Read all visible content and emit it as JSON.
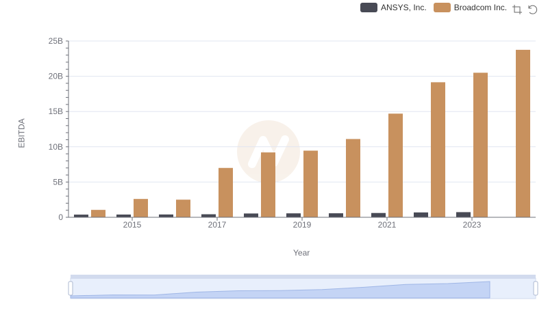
{
  "legend": [
    {
      "name": "ANSYS, Inc.",
      "color": "#484a55"
    },
    {
      "name": "Broadcom Inc.",
      "color": "#c8915e"
    }
  ],
  "toolbox": {
    "icons": [
      "zoom-icon",
      "restore-icon"
    ]
  },
  "chart_data": {
    "type": "bar",
    "categories": [
      "2014",
      "2015",
      "2016",
      "2017",
      "2018",
      "2019",
      "2020",
      "2021",
      "2022",
      "2023",
      "2024"
    ],
    "x_tick_labels": [
      "2015",
      "2017",
      "2019",
      "2021",
      "2023"
    ],
    "xlabel": "Year",
    "ylabel": "EBITDA",
    "ylim": [
      0,
      25000000000
    ],
    "y_tick_labels": [
      "0",
      "5B",
      "10B",
      "15B",
      "20B",
      "25B"
    ],
    "series": [
      {
        "name": "ANSYS, Inc.",
        "color": "#484a55",
        "values": [
          380000000,
          390000000,
          400000000,
          430000000,
          540000000,
          560000000,
          570000000,
          610000000,
          690000000,
          730000000,
          null
        ]
      },
      {
        "name": "Broadcom Inc.",
        "color": "#c8915e",
        "values": [
          1050000000,
          2600000000,
          2500000000,
          7000000000,
          9200000000,
          9450000000,
          11100000000,
          14700000000,
          19150000000,
          20500000000,
          23750000000
        ]
      }
    ],
    "grid": true,
    "legend_position": "top-right"
  }
}
